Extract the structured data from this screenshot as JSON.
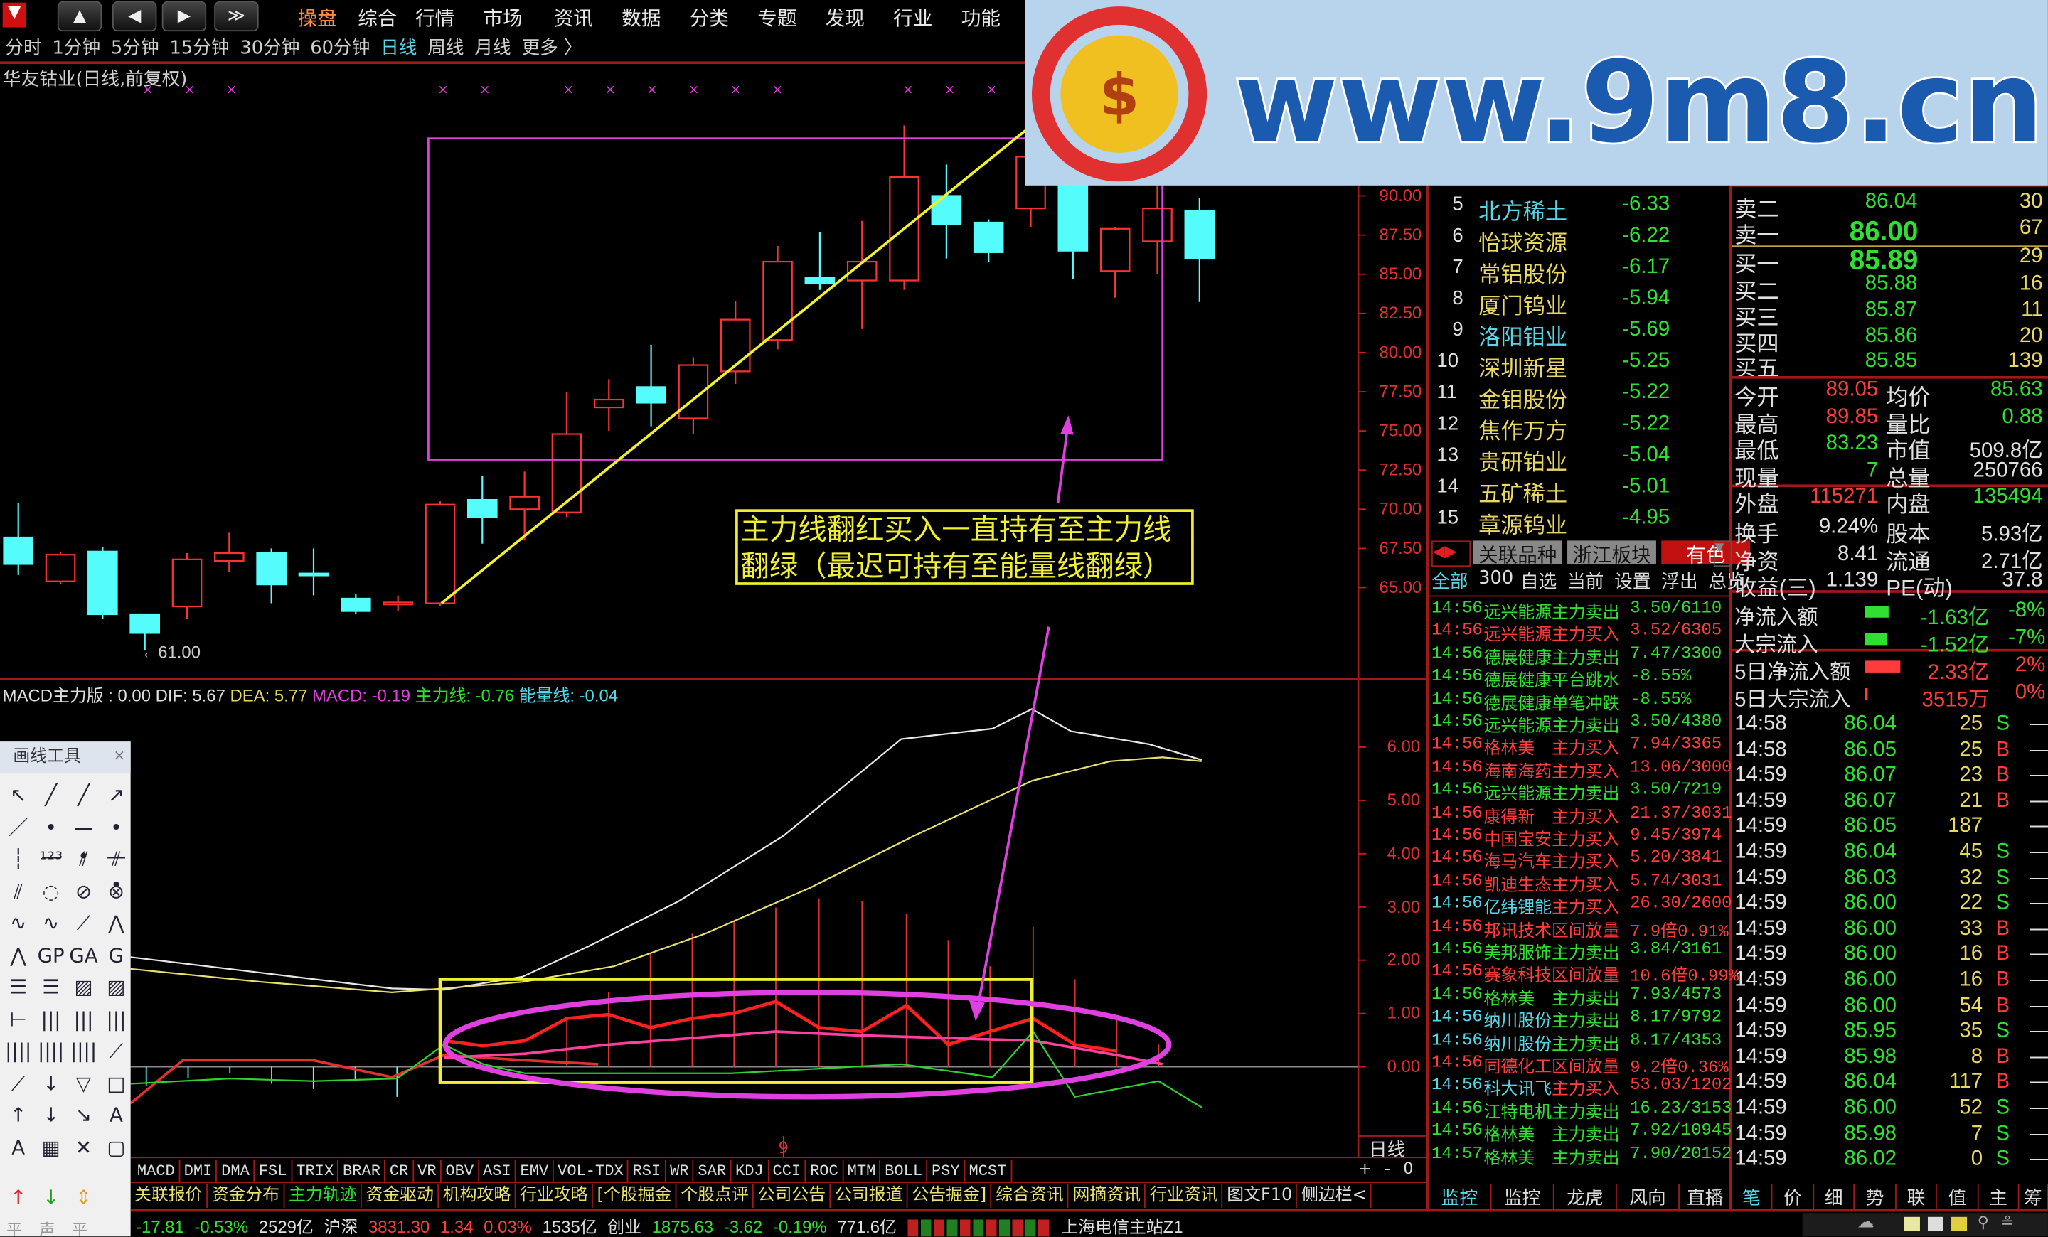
{
  "top_menu": {
    "nav_buttons": [
      "home",
      "back",
      "forward",
      "more"
    ],
    "items": [
      "操盘",
      "综合",
      "行情",
      "市场",
      "资讯",
      "数据",
      "分类",
      "专题",
      "发现",
      "行业",
      "功能"
    ],
    "active": "操盘"
  },
  "periods": {
    "items": [
      "分时",
      "1分钟",
      "5分钟",
      "15分钟",
      "30分钟",
      "60分钟",
      "日线",
      "周线",
      "月线",
      "更多 〉"
    ],
    "active": "日线"
  },
  "chart": {
    "stock_title": "华友钴业(日线,前复权)",
    "price_ticks": [
      "90.00",
      "87.50",
      "85.00",
      "82.50",
      "80.00",
      "77.50",
      "75.00",
      "72.50",
      "70.00",
      "67.50",
      "65.00"
    ],
    "low_marker": "←61.00",
    "candles": [
      [
        68.2,
        70.4,
        65.8,
        66.5
      ],
      [
        65.4,
        67.3,
        65.2,
        67.1
      ],
      [
        67.3,
        67.6,
        63.0,
        63.3
      ],
      [
        63.3,
        63.3,
        61.0,
        62.1
      ],
      [
        63.8,
        67.2,
        63.0,
        66.8
      ],
      [
        66.7,
        68.5,
        66.0,
        67.2
      ],
      [
        67.2,
        67.5,
        64.0,
        65.2
      ],
      [
        65.9,
        67.5,
        64.5,
        65.8
      ],
      [
        64.3,
        64.6,
        63.3,
        63.5
      ],
      [
        64.0,
        64.5,
        63.5,
        64.05
      ],
      [
        64.0,
        70.5,
        63.8,
        70.3
      ],
      [
        70.6,
        72.1,
        67.8,
        69.5
      ],
      [
        70.0,
        72.4,
        68.0,
        70.8
      ],
      [
        69.8,
        77.5,
        69.5,
        74.8
      ],
      [
        76.5,
        78.3,
        75.0,
        77.0
      ],
      [
        77.8,
        80.5,
        75.3,
        76.8
      ],
      [
        75.8,
        79.7,
        74.8,
        79.2
      ],
      [
        78.8,
        83.3,
        78.0,
        82.1
      ],
      [
        80.8,
        86.8,
        80.2,
        85.8
      ],
      [
        84.8,
        87.7,
        84.0,
        84.4
      ],
      [
        84.6,
        88.4,
        81.5,
        85.8
      ],
      [
        84.6,
        94.5,
        84.0,
        91.2
      ],
      [
        90.0,
        92.0,
        86.0,
        88.2
      ],
      [
        88.3,
        88.5,
        85.8,
        86.4
      ],
      [
        89.2,
        95.0,
        88.0,
        92.5
      ],
      [
        90.7,
        93.0,
        84.7,
        86.5
      ],
      [
        85.2,
        88.0,
        83.5,
        87.9
      ],
      [
        87.1,
        92.0,
        85.0,
        89.2
      ],
      [
        89.05,
        89.85,
        83.23,
        86.0
      ]
    ],
    "annotation": [
      "主力线翻红买入一直持有至主力线",
      "翻绿（最迟可持有至能量线翻绿）"
    ],
    "colors": {
      "up": "#ff3232",
      "down": "#54fcfc",
      "box": "#e040e0",
      "trend": "#f0f030"
    }
  },
  "macd": {
    "name": "MACD主力版",
    "name_value": " : 0.00",
    "dif": "DIF: 5.67",
    "dea": "DEA: 5.77",
    "macd": "MACD: -0.19",
    "main_line": "主力线: -0.76",
    "energy_line": "能量线: -0.04",
    "ticks": [
      "6.00",
      "5.00",
      "4.00",
      "3.00",
      "2.00",
      "1.00",
      "0.00"
    ],
    "cursor_label": "9",
    "period_label": "日线"
  },
  "drawing_tools": {
    "title": "画线工具",
    "bottom_labels": [
      "平",
      "声",
      "平"
    ]
  },
  "indicator_tabs": [
    "MACD",
    "DMI",
    "DMA",
    "FSL",
    "TRIX",
    "BRAR",
    "CR",
    "VR",
    "OBV",
    "ASI",
    "EMV",
    "VOL-TDX",
    "RSI",
    "WR",
    "SAR",
    "KDJ",
    "CCI",
    "ROC",
    "MTM",
    "BOLL",
    "PSY",
    "MCST"
  ],
  "zoom_controls": [
    "+",
    "-",
    "0"
  ],
  "info_tabs": [
    "关联报价",
    "资金分布",
    "主力轨迹",
    "资金驱动",
    "机构攻略",
    "行业攻略",
    "[个股掘金",
    "个股点评",
    "公司公告",
    "公司报道",
    "公告掘金]",
    "综合资讯",
    "网摘资讯",
    "行业资讯",
    "图文F10",
    "侧边栏<"
  ],
  "status_bar": {
    "items": [
      {
        "t": "-17.81",
        "c": "g"
      },
      {
        "t": "-0.53%",
        "c": "g"
      },
      {
        "t": "2529亿",
        "c": "w"
      },
      {
        "t": "沪深",
        "c": "w"
      },
      {
        "t": "3831.30",
        "c": "r"
      },
      {
        "t": "1.34",
        "c": "r"
      },
      {
        "t": "0.03%",
        "c": "r"
      },
      {
        "t": "1535亿",
        "c": "w"
      },
      {
        "t": "创业",
        "c": "w"
      },
      {
        "t": "1875.63",
        "c": "g"
      },
      {
        "t": "-3.62",
        "c": "g"
      },
      {
        "t": "-0.19%",
        "c": "g"
      },
      {
        "t": "771.6亿",
        "c": "w"
      }
    ],
    "server": "上海电信主站Z1"
  },
  "ranking": [
    {
      "n": "5",
      "name": "北方稀土",
      "v": "-6.33",
      "c": "c"
    },
    {
      "n": "6",
      "name": "怡球资源",
      "v": "-6.22",
      "c": "y"
    },
    {
      "n": "7",
      "name": "常铝股份",
      "v": "-6.17",
      "c": "y"
    },
    {
      "n": "8",
      "name": "厦门钨业",
      "v": "-5.94",
      "c": "y"
    },
    {
      "n": "9",
      "name": "洛阳钼业",
      "v": "-5.69",
      "c": "c"
    },
    {
      "n": "10",
      "name": "深圳新星",
      "v": "-5.25",
      "c": "y"
    },
    {
      "n": "11",
      "name": "金钼股份",
      "v": "-5.22",
      "c": "y"
    },
    {
      "n": "12",
      "name": "焦作万方",
      "v": "-5.22",
      "c": "y"
    },
    {
      "n": "13",
      "name": "贵研铂业",
      "v": "-5.04",
      "c": "y"
    },
    {
      "n": "14",
      "name": "五矿稀土",
      "v": "-5.01",
      "c": "y"
    },
    {
      "n": "15",
      "name": "章源钨业",
      "v": "-4.95",
      "c": "y"
    }
  ],
  "sector_tabs": {
    "items": [
      "关联品种",
      "浙江板块",
      "有色"
    ],
    "active": "有色"
  },
  "filter_tabs": {
    "items": [
      "全部",
      "300",
      "自选",
      "当前",
      "设置",
      "浮出",
      "总览"
    ],
    "active": "全部"
  },
  "monitor": [
    {
      "t": "14:56",
      "name": "远兴能源",
      "act": "主力卖出",
      "v": "3.50/6110",
      "c": "g"
    },
    {
      "t": "14:56",
      "name": "远兴能源",
      "act": "主力买入",
      "v": "3.52/6305",
      "c": "r"
    },
    {
      "t": "14:56",
      "name": "德展健康",
      "act": "主力卖出",
      "v": "7.47/3300",
      "c": "g"
    },
    {
      "t": "14:56",
      "name": "德展健康",
      "act": "平台跳水",
      "v": "-8.55%",
      "c": "g"
    },
    {
      "t": "14:56",
      "name": "德展健康",
      "act": "单笔冲跌",
      "v": "-8.55%",
      "c": "g"
    },
    {
      "t": "14:56",
      "name": "远兴能源",
      "act": "主力卖出",
      "v": "3.50/4380",
      "c": "g"
    },
    {
      "t": "14:56",
      "name": "格林美",
      "act": "主力买入",
      "v": "7.94/3365",
      "c": "r"
    },
    {
      "t": "14:56",
      "name": "海南海药",
      "act": "主力买入",
      "v": "13.06/3000",
      "c": "r"
    },
    {
      "t": "14:56",
      "name": "远兴能源",
      "act": "主力卖出",
      "v": "3.50/7219",
      "c": "g"
    },
    {
      "t": "14:56",
      "name": "康得新",
      "act": "主力买入",
      "v": "21.37/3031",
      "c": "r"
    },
    {
      "t": "14:56",
      "name": "中国宝安",
      "act": "主力买入",
      "v": "9.45/3974",
      "c": "r"
    },
    {
      "t": "14:56",
      "name": "海马汽车",
      "act": "主力买入",
      "v": "5.20/3841",
      "c": "r"
    },
    {
      "t": "14:56",
      "name": "凯迪生态",
      "act": "主力买入",
      "v": "5.74/3031",
      "c": "r"
    },
    {
      "t": "14:56",
      "name": "亿纬锂能",
      "act": "主力买入",
      "v": "26.30/2600",
      "c": "r",
      "nc": "c"
    },
    {
      "t": "14:56",
      "name": "邦讯技术",
      "act": "区间放量",
      "v": "7.9倍0.91%",
      "c": "r"
    },
    {
      "t": "14:56",
      "name": "美邦服饰",
      "act": "主力卖出",
      "v": "3.84/3161",
      "c": "g"
    },
    {
      "t": "14:56",
      "name": "赛象科技",
      "act": "区间放量",
      "v": "10.6倍0.99%",
      "c": "r"
    },
    {
      "t": "14:56",
      "name": "格林美",
      "act": "主力卖出",
      "v": "7.93/4573",
      "c": "g"
    },
    {
      "t": "14:56",
      "name": "纳川股份",
      "act": "主力卖出",
      "v": "8.17/9792",
      "c": "g",
      "nc": "c"
    },
    {
      "t": "14:56",
      "name": "纳川股份",
      "act": "主力卖出",
      "v": "8.17/4353",
      "c": "g",
      "nc": "c"
    },
    {
      "t": "14:56",
      "name": "同德化工",
      "act": "区间放量",
      "v": "9.2倍0.36%",
      "c": "r"
    },
    {
      "t": "14:56",
      "name": "科大讯飞",
      "act": "主力买入",
      "v": "53.03/1202",
      "c": "r",
      "nc": "c"
    },
    {
      "t": "14:56",
      "name": "江特电机",
      "act": "主力卖出",
      "v": "16.23/3153",
      "c": "g"
    },
    {
      "t": "14:56",
      "name": "格林美",
      "act": "主力卖出",
      "v": "7.92/10945",
      "c": "g"
    },
    {
      "t": "14:57",
      "name": "格林美",
      "act": "主力卖出",
      "v": "7.90/20152",
      "c": "g"
    }
  ],
  "order_book": [
    {
      "l": "卖二",
      "p": "86.04",
      "q": "30"
    },
    {
      "l": "卖一",
      "p": "86.00",
      "q": "67",
      "big": true
    },
    {
      "l": "买一",
      "p": "85.89",
      "q": "29",
      "big": true
    },
    {
      "l": "买二",
      "p": "85.88",
      "q": "16"
    },
    {
      "l": "买三",
      "p": "85.87",
      "q": "11"
    },
    {
      "l": "买四",
      "p": "85.86",
      "q": "20"
    },
    {
      "l": "买五",
      "p": "85.85",
      "q": "139"
    }
  ],
  "stats": [
    {
      "l1": "今开",
      "v1": "89.05",
      "c1": "r",
      "l2": "均价",
      "v2": "85.63",
      "c2": "g"
    },
    {
      "l1": "最高",
      "v1": "89.85",
      "c1": "r",
      "l2": "量比",
      "v2": "0.88",
      "c2": "g"
    },
    {
      "l1": "最低",
      "v1": "83.23",
      "c1": "g",
      "l2": "市值",
      "v2": "509.8亿",
      "c2": "w"
    },
    {
      "l1": "现量",
      "v1": "7",
      "c1": "g",
      "l2": "总量",
      "v2": "250766",
      "c2": "w"
    },
    {
      "l1": "外盘",
      "v1": "115271",
      "c1": "r",
      "l2": "内盘",
      "v2": "135494",
      "c2": "g"
    }
  ],
  "finance": [
    {
      "l1": "换手",
      "v1": "9.24%",
      "l2": "股本",
      "v2": "5.93亿"
    },
    {
      "l1": "净资",
      "v1": "8.41",
      "l2": "流通",
      "v2": "2.71亿"
    },
    {
      "l1": "收益(三)",
      "v1": "1.139",
      "l2": "PE(动)",
      "v2": "37.8"
    }
  ],
  "flows": [
    {
      "l": "净流入额",
      "v": "-1.63亿",
      "p": "-8%",
      "c": "g",
      "bar": 0.5
    },
    {
      "l": "大宗流入",
      "v": "-1.52亿",
      "p": "-7%",
      "c": "g",
      "bar": 0.47
    },
    {
      "l": "5日净流入额",
      "v": "2.33亿",
      "p": "2%",
      "c": "r",
      "bar": 0.75
    },
    {
      "l": "5日大宗流入",
      "v": "3515万",
      "p": "0%",
      "c": "r",
      "bar": 0.05
    }
  ],
  "ticks": [
    {
      "t": "14:58",
      "p": "86.04",
      "q": "25",
      "s": "S"
    },
    {
      "t": "14:58",
      "p": "86.05",
      "q": "25",
      "s": "B"
    },
    {
      "t": "14:59",
      "p": "86.07",
      "q": "23",
      "s": "B"
    },
    {
      "t": "14:59",
      "p": "86.07",
      "q": "21",
      "s": "B"
    },
    {
      "t": "14:59",
      "p": "86.05",
      "q": "187",
      "s": ""
    },
    {
      "t": "14:59",
      "p": "86.04",
      "q": "45",
      "s": "S"
    },
    {
      "t": "14:59",
      "p": "86.03",
      "q": "32",
      "s": "S"
    },
    {
      "t": "14:59",
      "p": "86.00",
      "q": "22",
      "s": "S"
    },
    {
      "t": "14:59",
      "p": "86.00",
      "q": "33",
      "s": "B"
    },
    {
      "t": "14:59",
      "p": "86.00",
      "q": "16",
      "s": "B"
    },
    {
      "t": "14:59",
      "p": "86.00",
      "q": "16",
      "s": "B"
    },
    {
      "t": "14:59",
      "p": "86.00",
      "q": "54",
      "s": "B"
    },
    {
      "t": "14:59",
      "p": "85.95",
      "q": "35",
      "s": "S"
    },
    {
      "t": "14:59",
      "p": "85.98",
      "q": "8",
      "s": "B"
    },
    {
      "t": "14:59",
      "p": "86.04",
      "q": "117",
      "s": "B"
    },
    {
      "t": "14:59",
      "p": "86.00",
      "q": "52",
      "s": "S"
    },
    {
      "t": "14:59",
      "p": "85.98",
      "q": "7",
      "s": "S"
    },
    {
      "t": "14:59",
      "p": "86.02",
      "q": "0",
      "s": "S"
    }
  ],
  "tick_dash": "—",
  "right_bottom_tabs": {
    "items": [
      "监控",
      "监控",
      "龙虎",
      "风向",
      "直播",
      "笔",
      "价",
      "细",
      "势",
      "联",
      "值",
      "主",
      "筹"
    ],
    "active": [
      "监控",
      "笔"
    ]
  },
  "watermark": {
    "text": "www.9m8.cn",
    "seal": "www.9m8.cn"
  }
}
